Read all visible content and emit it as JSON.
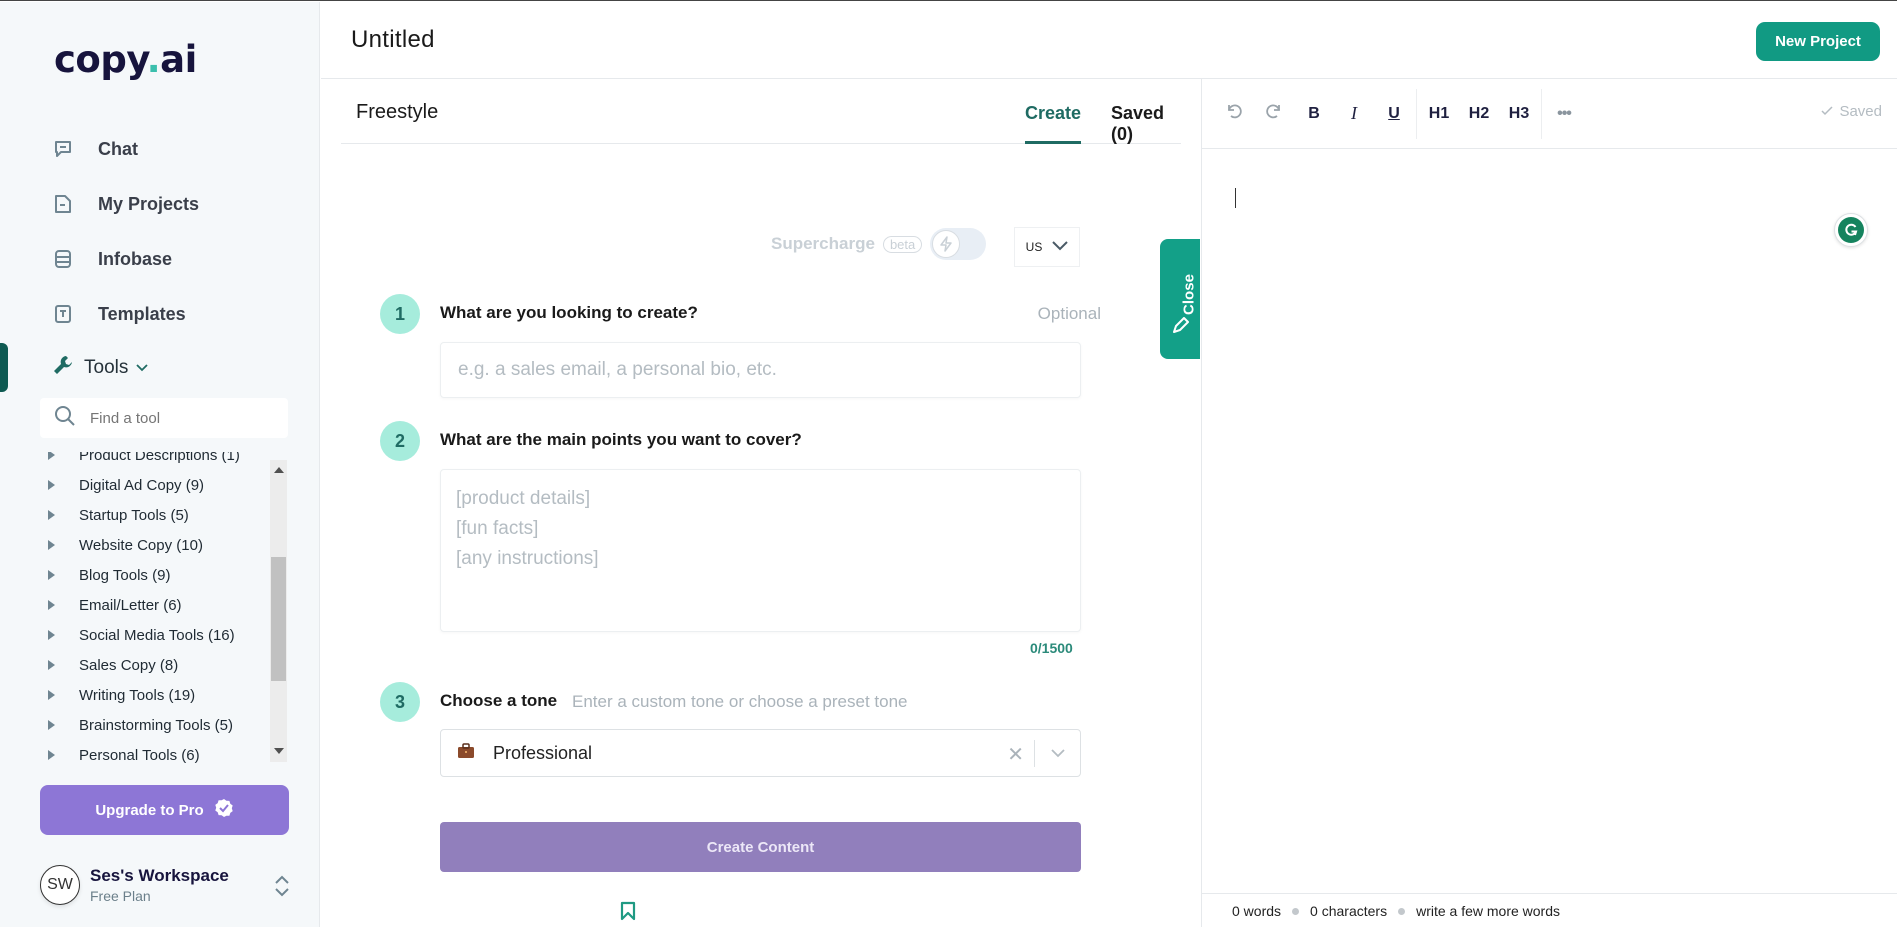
{
  "app": {
    "logo_text_main": "copy",
    "logo_text_dot": ".",
    "logo_text_suffix": "ai"
  },
  "sidebar": {
    "nav": [
      {
        "label": "Chat",
        "icon": "chat-icon"
      },
      {
        "label": "My Projects",
        "icon": "document-icon"
      },
      {
        "label": "Infobase",
        "icon": "database-icon"
      },
      {
        "label": "Templates",
        "icon": "template-icon"
      }
    ],
    "tools": {
      "label": "Tools",
      "icon": "wrench-icon",
      "search_placeholder": "Find a tool",
      "categories": [
        "Product Descriptions (1)",
        "Digital Ad Copy (9)",
        "Startup Tools (5)",
        "Website Copy (10)",
        "Blog Tools (9)",
        "Email/Letter (6)",
        "Social Media Tools (16)",
        "Sales Copy (8)",
        "Writing Tools (19)",
        "Brainstorming Tools (5)",
        "Personal Tools (6)"
      ]
    },
    "upgrade_label": "Upgrade to Pro",
    "workspace": {
      "initials": "SW",
      "name": "Ses's Workspace",
      "plan": "Free Plan"
    }
  },
  "header": {
    "title": "Untitled",
    "new_project_label": "New Project"
  },
  "freestyle": {
    "title": "Freestyle",
    "tabs": [
      {
        "label": "Create",
        "active": true
      },
      {
        "label": "Saved (0)",
        "active": false
      }
    ],
    "supercharge_label": "Supercharge",
    "supercharge_badge": "beta",
    "supercharge_on": false,
    "language": "US",
    "steps": [
      {
        "number": "1",
        "label": "What are you looking to create?",
        "optional_label": "Optional",
        "placeholder": "e.g. a sales email, a personal bio, etc.",
        "value": ""
      },
      {
        "number": "2",
        "label": "What are the main points you want to cover?",
        "placeholder": "[product details]\n[fun facts]\n[any instructions]",
        "value": "",
        "counter": "0/1500"
      },
      {
        "number": "3",
        "label": "Choose a tone",
        "hint": "Enter a custom tone or choose a preset tone",
        "selected_tone": "Professional",
        "tone_icon": "briefcase-icon"
      }
    ],
    "create_label": "Create Content",
    "close_tab_label": "Close"
  },
  "editor": {
    "toolbar": {
      "undo": "undo-icon",
      "redo": "redo-icon",
      "bold": "B",
      "italic": "I",
      "underline": "U",
      "h1": "H1",
      "h2": "H2",
      "h3": "H3",
      "more": "•••"
    },
    "saved_label": "Saved",
    "status": {
      "words": "0 words",
      "characters": "0 characters",
      "hint": "write a few more words"
    }
  }
}
